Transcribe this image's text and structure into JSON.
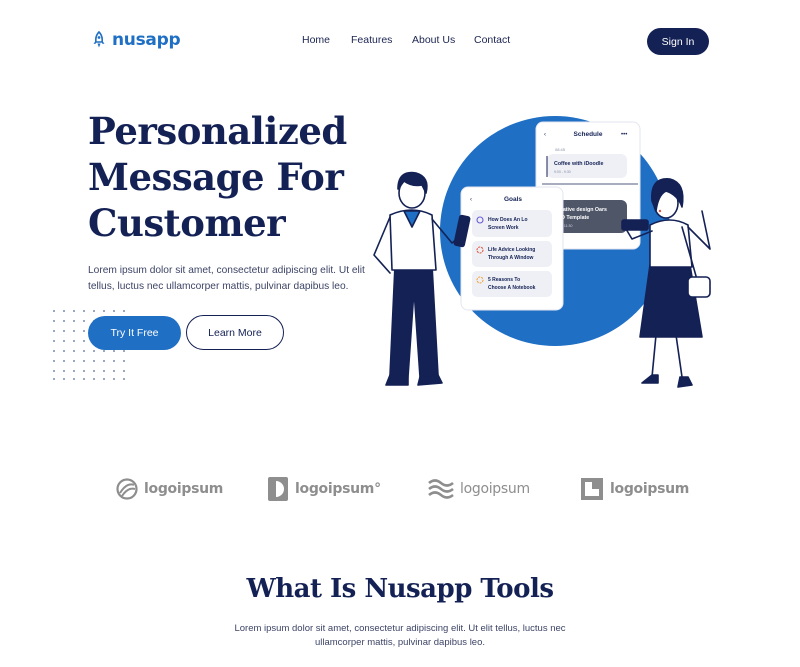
{
  "brand": {
    "name": "nusapp",
    "logo_icon": "rocket-icon",
    "accent": "#1f6fc4",
    "navy": "#142155"
  },
  "nav": {
    "links": [
      "Home",
      "Features",
      "About Us",
      "Contact"
    ],
    "signin_label": "Sign In"
  },
  "hero": {
    "title_lines": [
      "Personalized",
      "Message For",
      "Customer"
    ],
    "description": "Lorem ipsum dolor sit amet, consectetur adipiscing elit. Ut elit tellus, luctus nec ullamcorper mattis, pulvinar dapibus leo.",
    "primary_cta": "Try It Free",
    "secondary_cta": "Learn More"
  },
  "illustration": {
    "schedule_card": {
      "title": "Schedule",
      "time1": "08:45",
      "event1_title": "Coffee with iDoodle",
      "event1_time": "9:00 - 9:30",
      "time2": "9:00",
      "event2_title_line1": "Creative design Oars",
      "event2_title_line2": "PSD Template",
      "event2_time": "9:15 - 11:30"
    },
    "goals_card": {
      "title": "Goals",
      "items": [
        {
          "line1": "How Does An Lo",
          "line2": "Screen Work",
          "color": "#6b5bd6"
        },
        {
          "line1": "Life Advice Looking",
          "line2": "Through A Window",
          "color": "#e0533d"
        },
        {
          "line1": "5 Reasons To",
          "line2": "Choose A Notebook",
          "color": "#f2a33a"
        }
      ]
    }
  },
  "partner_logos": [
    {
      "name": "logoipsum",
      "icon": "globe-slash-icon"
    },
    {
      "name": "logoipsum°",
      "icon": "half-circle-icon"
    },
    {
      "name": "logoipsum",
      "icon": "waves-icon"
    },
    {
      "name": "logoipsum",
      "icon": "square-key-icon"
    }
  ],
  "section2": {
    "title": "What Is Nusapp Tools",
    "description_line1": "Lorem ipsum dolor sit amet, consectetur adipiscing elit. Ut elit tellus, luctus nec",
    "description_line2": "ullamcorper mattis, pulvinar dapibus leo."
  }
}
